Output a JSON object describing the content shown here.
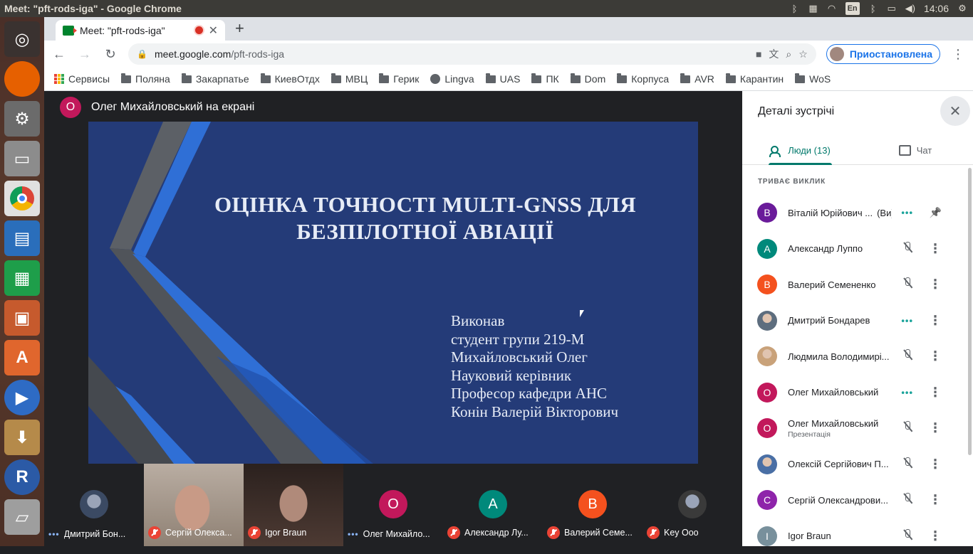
{
  "os": {
    "window_title": "Meet: \"pft-rods-iga\" - Google Chrome",
    "keyboard_layout": "En",
    "clock": "14:06"
  },
  "browser": {
    "tab_title": "Meet: \"pft-rods-iga\"",
    "url_host": "meet.google.com",
    "url_path": "/pft-rods-iga",
    "profile_label": "Приостановлена",
    "bookmarks": [
      "Сервисы",
      "Поляна",
      "Закарпатье",
      "КиевОтдх",
      "МВЦ",
      "Герик",
      "Lingva",
      "UAS",
      "ПК",
      "Dom",
      "Корпуса",
      "AVR",
      "Карантин",
      "WoS"
    ]
  },
  "meeting": {
    "presenter_initial": "О",
    "presenter_label": "Олег Михайловський на екрані",
    "slide": {
      "title": "ОЦІНКА ТОЧНОСТІ MULTI-GNSS ДЛЯ БЕЗПІЛОТНОЇ АВІАЦІЇ",
      "lines": [
        "Виконав",
        "студент групи 219-М",
        "Михайловський Олег",
        "Науковий керівник",
        "Професор кафедри АНС",
        "Конін Валерій Вікторович"
      ]
    },
    "tiles": [
      {
        "name": "Дмитрий Бон...",
        "initial": "",
        "state": "speaking",
        "color": "#3b4a63"
      },
      {
        "name": "Сергій Олекса...",
        "initial": "",
        "state": "muted",
        "color": "#8a7a6c"
      },
      {
        "name": "Igor Braun",
        "initial": "",
        "state": "muted",
        "color": "#4a3b36"
      },
      {
        "name": "Олег Михайло...",
        "initial": "О",
        "state": "speaking",
        "color": "#c2185b"
      },
      {
        "name": "Александр Лу...",
        "initial": "А",
        "state": "muted",
        "color": "#00897b"
      },
      {
        "name": "Валерий Семе...",
        "initial": "В",
        "state": "muted",
        "color": "#f4511e"
      },
      {
        "name": "Key Ooo",
        "initial": "",
        "state": "muted",
        "color": "#3a3a3a"
      }
    ]
  },
  "panel": {
    "title": "Деталі зустрічі",
    "tab_people": "Люди (13)",
    "tab_chat": "Чат",
    "section": "ТРИВАЄ ВИКЛИК",
    "participants": [
      {
        "initial": "В",
        "color": "#6a1b9a",
        "name": "Віталій Юрійович ...",
        "you": "(Ви)",
        "sub": "",
        "status": "speaking",
        "action": "pin"
      },
      {
        "initial": "А",
        "color": "#00897b",
        "name": "Александр Луппо",
        "you": "",
        "sub": "",
        "status": "muted",
        "action": "more"
      },
      {
        "initial": "В",
        "color": "#f4511e",
        "name": "Валерий Семененко",
        "you": "",
        "sub": "",
        "status": "muted",
        "action": "more"
      },
      {
        "initial": "",
        "color": "#5d6d7e",
        "name": "Дмитрий Бондарев",
        "you": "",
        "sub": "",
        "status": "speaking",
        "action": "more"
      },
      {
        "initial": "",
        "color": "#c9a27a",
        "name": "Людмила Володимирі...",
        "you": "",
        "sub": "",
        "status": "muted",
        "action": "more"
      },
      {
        "initial": "О",
        "color": "#c2185b",
        "name": "Олег Михайловський",
        "you": "",
        "sub": "",
        "status": "speaking",
        "action": "more"
      },
      {
        "initial": "О",
        "color": "#c2185b",
        "name": "Олег Михайловський",
        "you": "",
        "sub": "Презентація",
        "status": "muted",
        "action": "more"
      },
      {
        "initial": "",
        "color": "#4a6fa5",
        "name": "Олексій Сергійович П...",
        "you": "",
        "sub": "",
        "status": "muted",
        "action": "more"
      },
      {
        "initial": "С",
        "color": "#8e24aa",
        "name": "Сергій Олександрови...",
        "you": "",
        "sub": "",
        "status": "muted",
        "action": "more"
      },
      {
        "initial": "I",
        "color": "#78909c",
        "name": "Igor Braun",
        "you": "",
        "sub": "",
        "status": "muted",
        "action": "more"
      }
    ]
  }
}
